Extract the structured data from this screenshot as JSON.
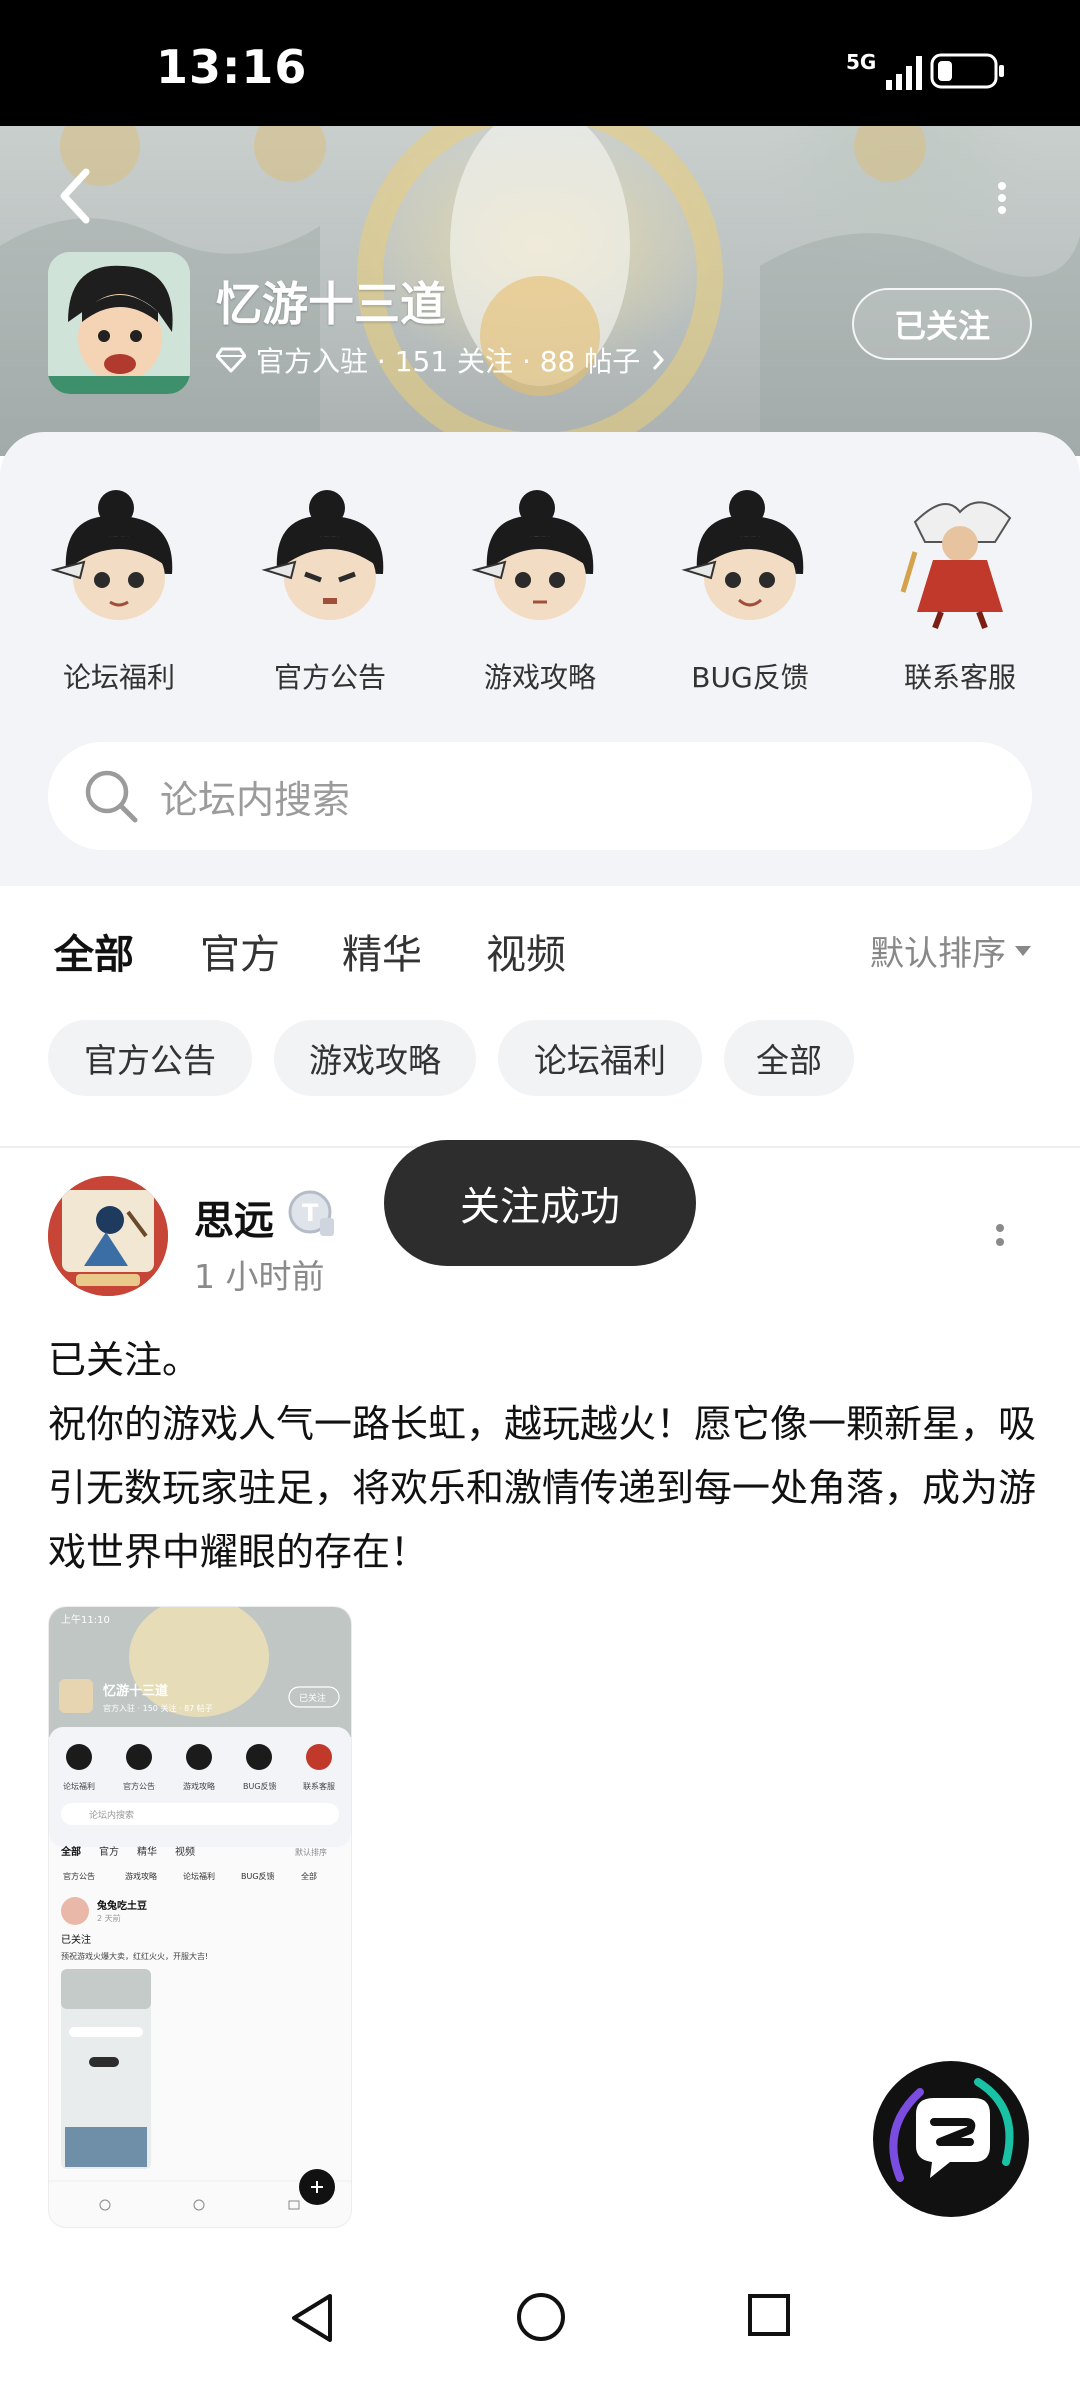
{
  "status_bar": {
    "time": "13:16",
    "network": "5G"
  },
  "forum": {
    "title": "忆游十三道",
    "meta": "官方入驻 · 151 关注 · 88 帖子",
    "follow_button": "已关注"
  },
  "quick_links": [
    {
      "label": "论坛福利"
    },
    {
      "label": "官方公告"
    },
    {
      "label": "游戏攻略"
    },
    {
      "label": "BUG反馈"
    },
    {
      "label": "联系客服"
    }
  ],
  "search": {
    "placeholder": "论坛内搜索"
  },
  "tabs": [
    {
      "label": "全部",
      "active": true
    },
    {
      "label": "官方"
    },
    {
      "label": "精华"
    },
    {
      "label": "视频"
    }
  ],
  "sort": {
    "label": "默认排序"
  },
  "chips": [
    {
      "label": "官方公告"
    },
    {
      "label": "游戏攻略"
    },
    {
      "label": "论坛福利"
    },
    {
      "label": "全部"
    }
  ],
  "post": {
    "author": "思远",
    "time": "1 小时前",
    "content_line1": "已关注。",
    "content_line2": "祝你的游戏人气一路长虹，越玩越火！愿它像一颗新星，吸引无数玩家驻足，将欢乐和激情传递到每一处角落，成为游戏世界中耀眼的存在！"
  },
  "screenshot_thumb": {
    "time": "上午11:10",
    "title": "忆游十三道",
    "follow": "已关注",
    "meta": "官方入驻 · 150 关注 · 87 帖子",
    "quick_labels": [
      "论坛福利",
      "官方公告",
      "游戏攻略",
      "BUG反馈",
      "联系客服"
    ],
    "search": "论坛内搜索",
    "tabs": [
      "全部",
      "官方",
      "精华",
      "视频"
    ],
    "sort": "默认排序",
    "chips": [
      "官方公告",
      "游戏攻略",
      "论坛福利",
      "BUG反馈",
      "全部"
    ],
    "post_author": "兔兔吃土豆",
    "post_time": "2 天前",
    "post_line1": "已关注",
    "post_line2": "预祝游戏火爆大卖，红红火火，开服大吉!"
  },
  "toast": {
    "text": "关注成功"
  },
  "colors": {
    "accent": "#19c2a4",
    "toast_bg": "#2d2d2d",
    "panel_bg": "#f3f4f8"
  }
}
